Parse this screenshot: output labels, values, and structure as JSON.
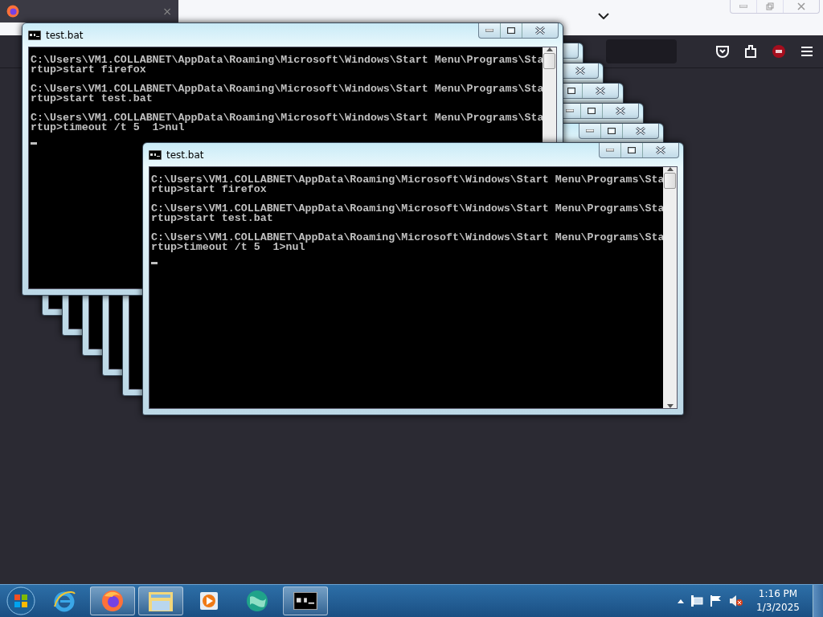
{
  "browser": {
    "tab_close": "×"
  },
  "console_windows": [
    {
      "title": "test.bat",
      "blocks": [
        {
          "lines": [
            "C:\\Users\\VM1.COLLABNET\\AppData\\Roaming\\Microsoft\\Windows\\Start Menu\\Programs\\Sta",
            "rtup>start firefox"
          ]
        },
        {
          "lines": [
            "C:\\Users\\VM1.COLLABNET\\AppData\\Roaming\\Microsoft\\Windows\\Start Menu\\Programs\\Sta",
            "rtup>start test.bat"
          ]
        },
        {
          "lines": [
            "C:\\Users\\VM1.COLLABNET\\AppData\\Roaming\\Microsoft\\Windows\\Start Menu\\Programs\\Sta",
            "rtup>timeout /t 5  1>nul"
          ]
        }
      ]
    },
    {
      "title": "test.bat",
      "blocks": [
        {
          "lines": [
            "C:\\Users\\VM1.COLLABNET\\AppData\\Roaming\\Microsoft\\Windows\\Start Menu\\Programs\\Sta",
            "rtup>start firefox"
          ]
        },
        {
          "lines": [
            "C:\\Users\\VM1.COLLABNET\\AppData\\Roaming\\Microsoft\\Windows\\Start Menu\\Programs\\Sta",
            "rtup>start test.bat"
          ]
        },
        {
          "lines": [
            "C:\\Users\\VM1.COLLABNET\\AppData\\Roaming\\Microsoft\\Windows\\Start Menu\\Programs\\Sta",
            "rtup>timeout /t 5  1>nul"
          ]
        }
      ]
    }
  ],
  "taskbar": {
    "apps": [
      {
        "kind": "ie",
        "running": false
      },
      {
        "kind": "firefox",
        "running": true
      },
      {
        "kind": "explorer",
        "running": true
      },
      {
        "kind": "media",
        "running": false
      },
      {
        "kind": "globe",
        "running": false
      },
      {
        "kind": "console",
        "running": true
      }
    ],
    "clock": {
      "time": "1:16 PM",
      "date": "1/3/2025"
    }
  }
}
